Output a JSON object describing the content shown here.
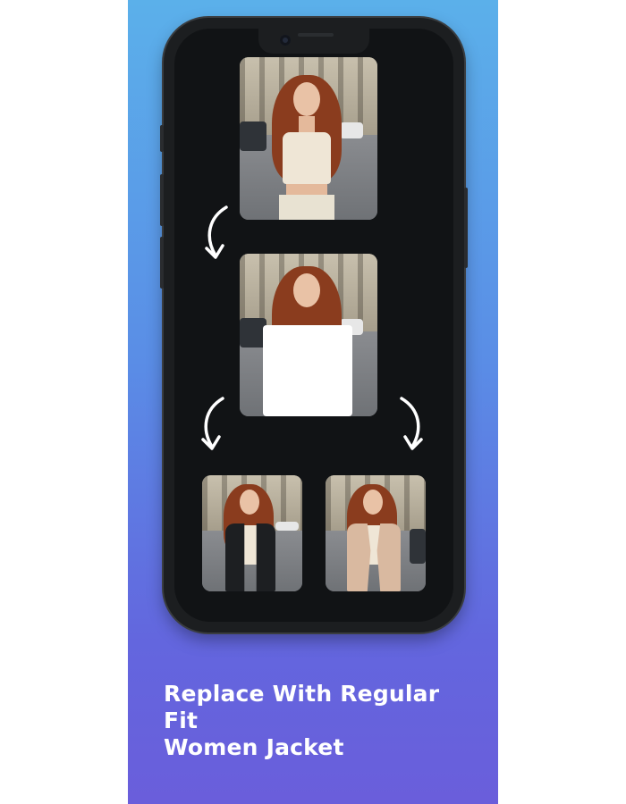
{
  "caption": {
    "line1": "Replace With Regular Fit",
    "line2": "Women Jacket"
  },
  "icons": {
    "arrow": "curved-arrow-down-icon",
    "camera": "front-camera-icon"
  },
  "colors": {
    "background_top": "#5bb0ea",
    "background_bottom": "#6a5edb",
    "screen": "#111315",
    "mask": "#ffffff",
    "jacket_black": "#1d1f22",
    "jacket_beige": "#d9b9a0",
    "arrow": "#ffffff"
  }
}
